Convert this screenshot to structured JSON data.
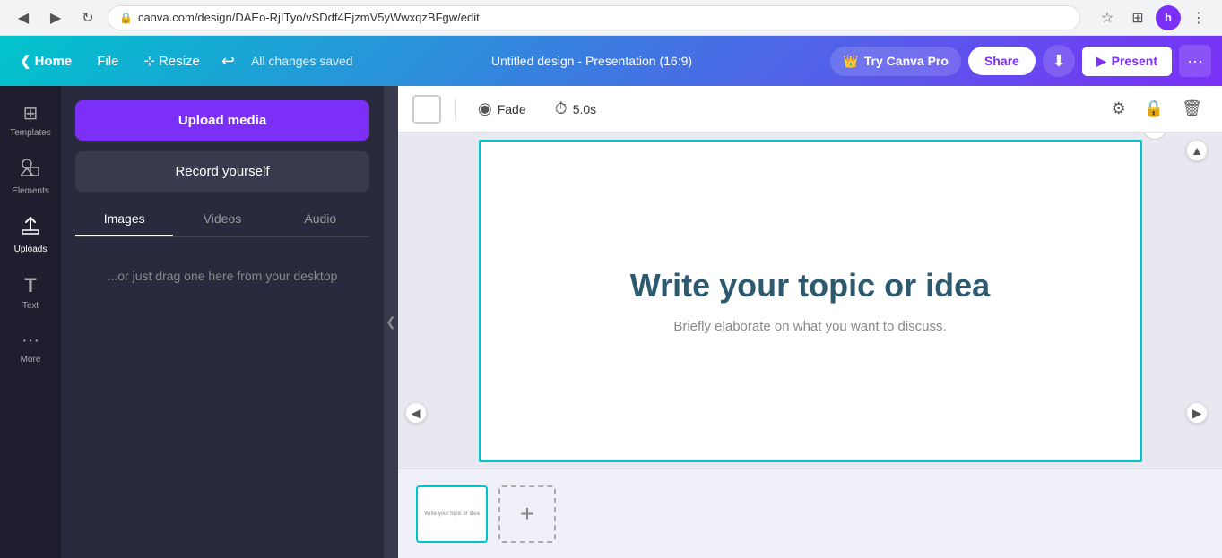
{
  "browser": {
    "url": "canva.com/design/DAEo-RjITyo/vSDdf4EjzmV5yWwxqzBFgw/edit",
    "back_btn": "◀",
    "forward_btn": "▶",
    "refresh_btn": "↻",
    "star_icon": "☆",
    "extensions_icon": "⊞",
    "profile_initial": "h",
    "more_icon": "⋮"
  },
  "header": {
    "home_label": "Home",
    "chevron_left": "❮",
    "file_label": "File",
    "resize_label": "Resize",
    "resize_icon": "⊹",
    "undo_icon": "↩",
    "saved_text": "All changes saved",
    "title": "Untitled design - Presentation (16:9)",
    "try_pro_label": "Try Canva Pro",
    "crown_icon": "👑",
    "share_label": "Share",
    "download_icon": "⬇",
    "present_icon": "▶",
    "present_label": "Present",
    "more_icon": "···"
  },
  "sidebar": {
    "items": [
      {
        "icon": "⊞",
        "label": "Templates",
        "active": false
      },
      {
        "icon": "⬡",
        "label": "Elements",
        "active": false
      },
      {
        "icon": "⬆",
        "label": "Uploads",
        "active": true
      },
      {
        "icon": "T",
        "label": "Text",
        "active": false
      },
      {
        "icon": "···",
        "label": "More",
        "active": false
      }
    ]
  },
  "upload_panel": {
    "upload_btn_label": "Upload media",
    "record_btn_label": "Record yourself",
    "tabs": [
      "Images",
      "Videos",
      "Audio"
    ],
    "active_tab": "Images",
    "drag_hint": "...or just drag one here from your desktop"
  },
  "canvas_toolbar": {
    "fade_label": "Fade",
    "timer_label": "5.0s",
    "fade_icon": "◉",
    "timer_icon": "⏱",
    "color_label": "white",
    "filter_icon": "⚙",
    "lock_icon": "🔒",
    "delete_icon": "🗑"
  },
  "slide": {
    "title": "Write your topic or idea",
    "subtitle": "Briefly elaborate on what you want to discuss.",
    "border_color": "#00c4cc"
  },
  "thumbnails": [
    {
      "text": "Write your topic or idea",
      "active": true
    }
  ],
  "add_slide_btn": "+",
  "collapse_icon": "❮"
}
